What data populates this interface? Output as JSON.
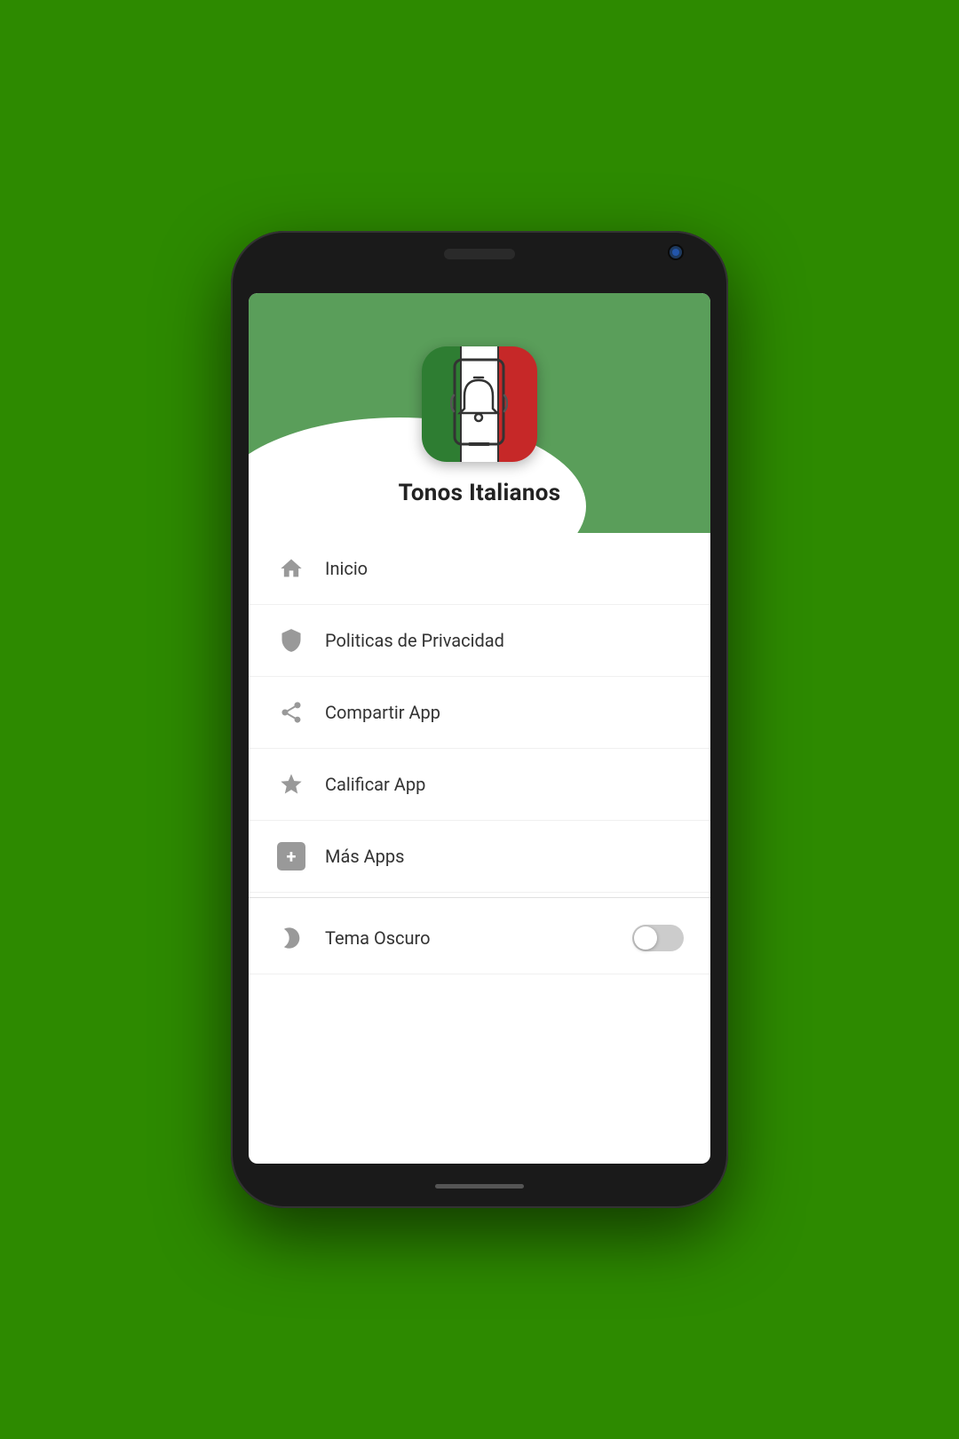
{
  "background_color": "#2d8a00",
  "app": {
    "title": "Tonos Italianos",
    "icon_alt": "Tonos Italianos App Icon"
  },
  "menu": {
    "items": [
      {
        "id": "inicio",
        "label": "Inicio",
        "icon": "home"
      },
      {
        "id": "privacidad",
        "label": "Politicas de Privacidad",
        "icon": "shield"
      },
      {
        "id": "compartir",
        "label": "Compartir App",
        "icon": "share"
      },
      {
        "id": "calificar",
        "label": "Calificar App",
        "icon": "star"
      },
      {
        "id": "mas-apps",
        "label": "Más Apps",
        "icon": "plus"
      }
    ],
    "tema_oscuro_label": "Tema Oscuro",
    "tema_oscuro_enabled": false
  }
}
